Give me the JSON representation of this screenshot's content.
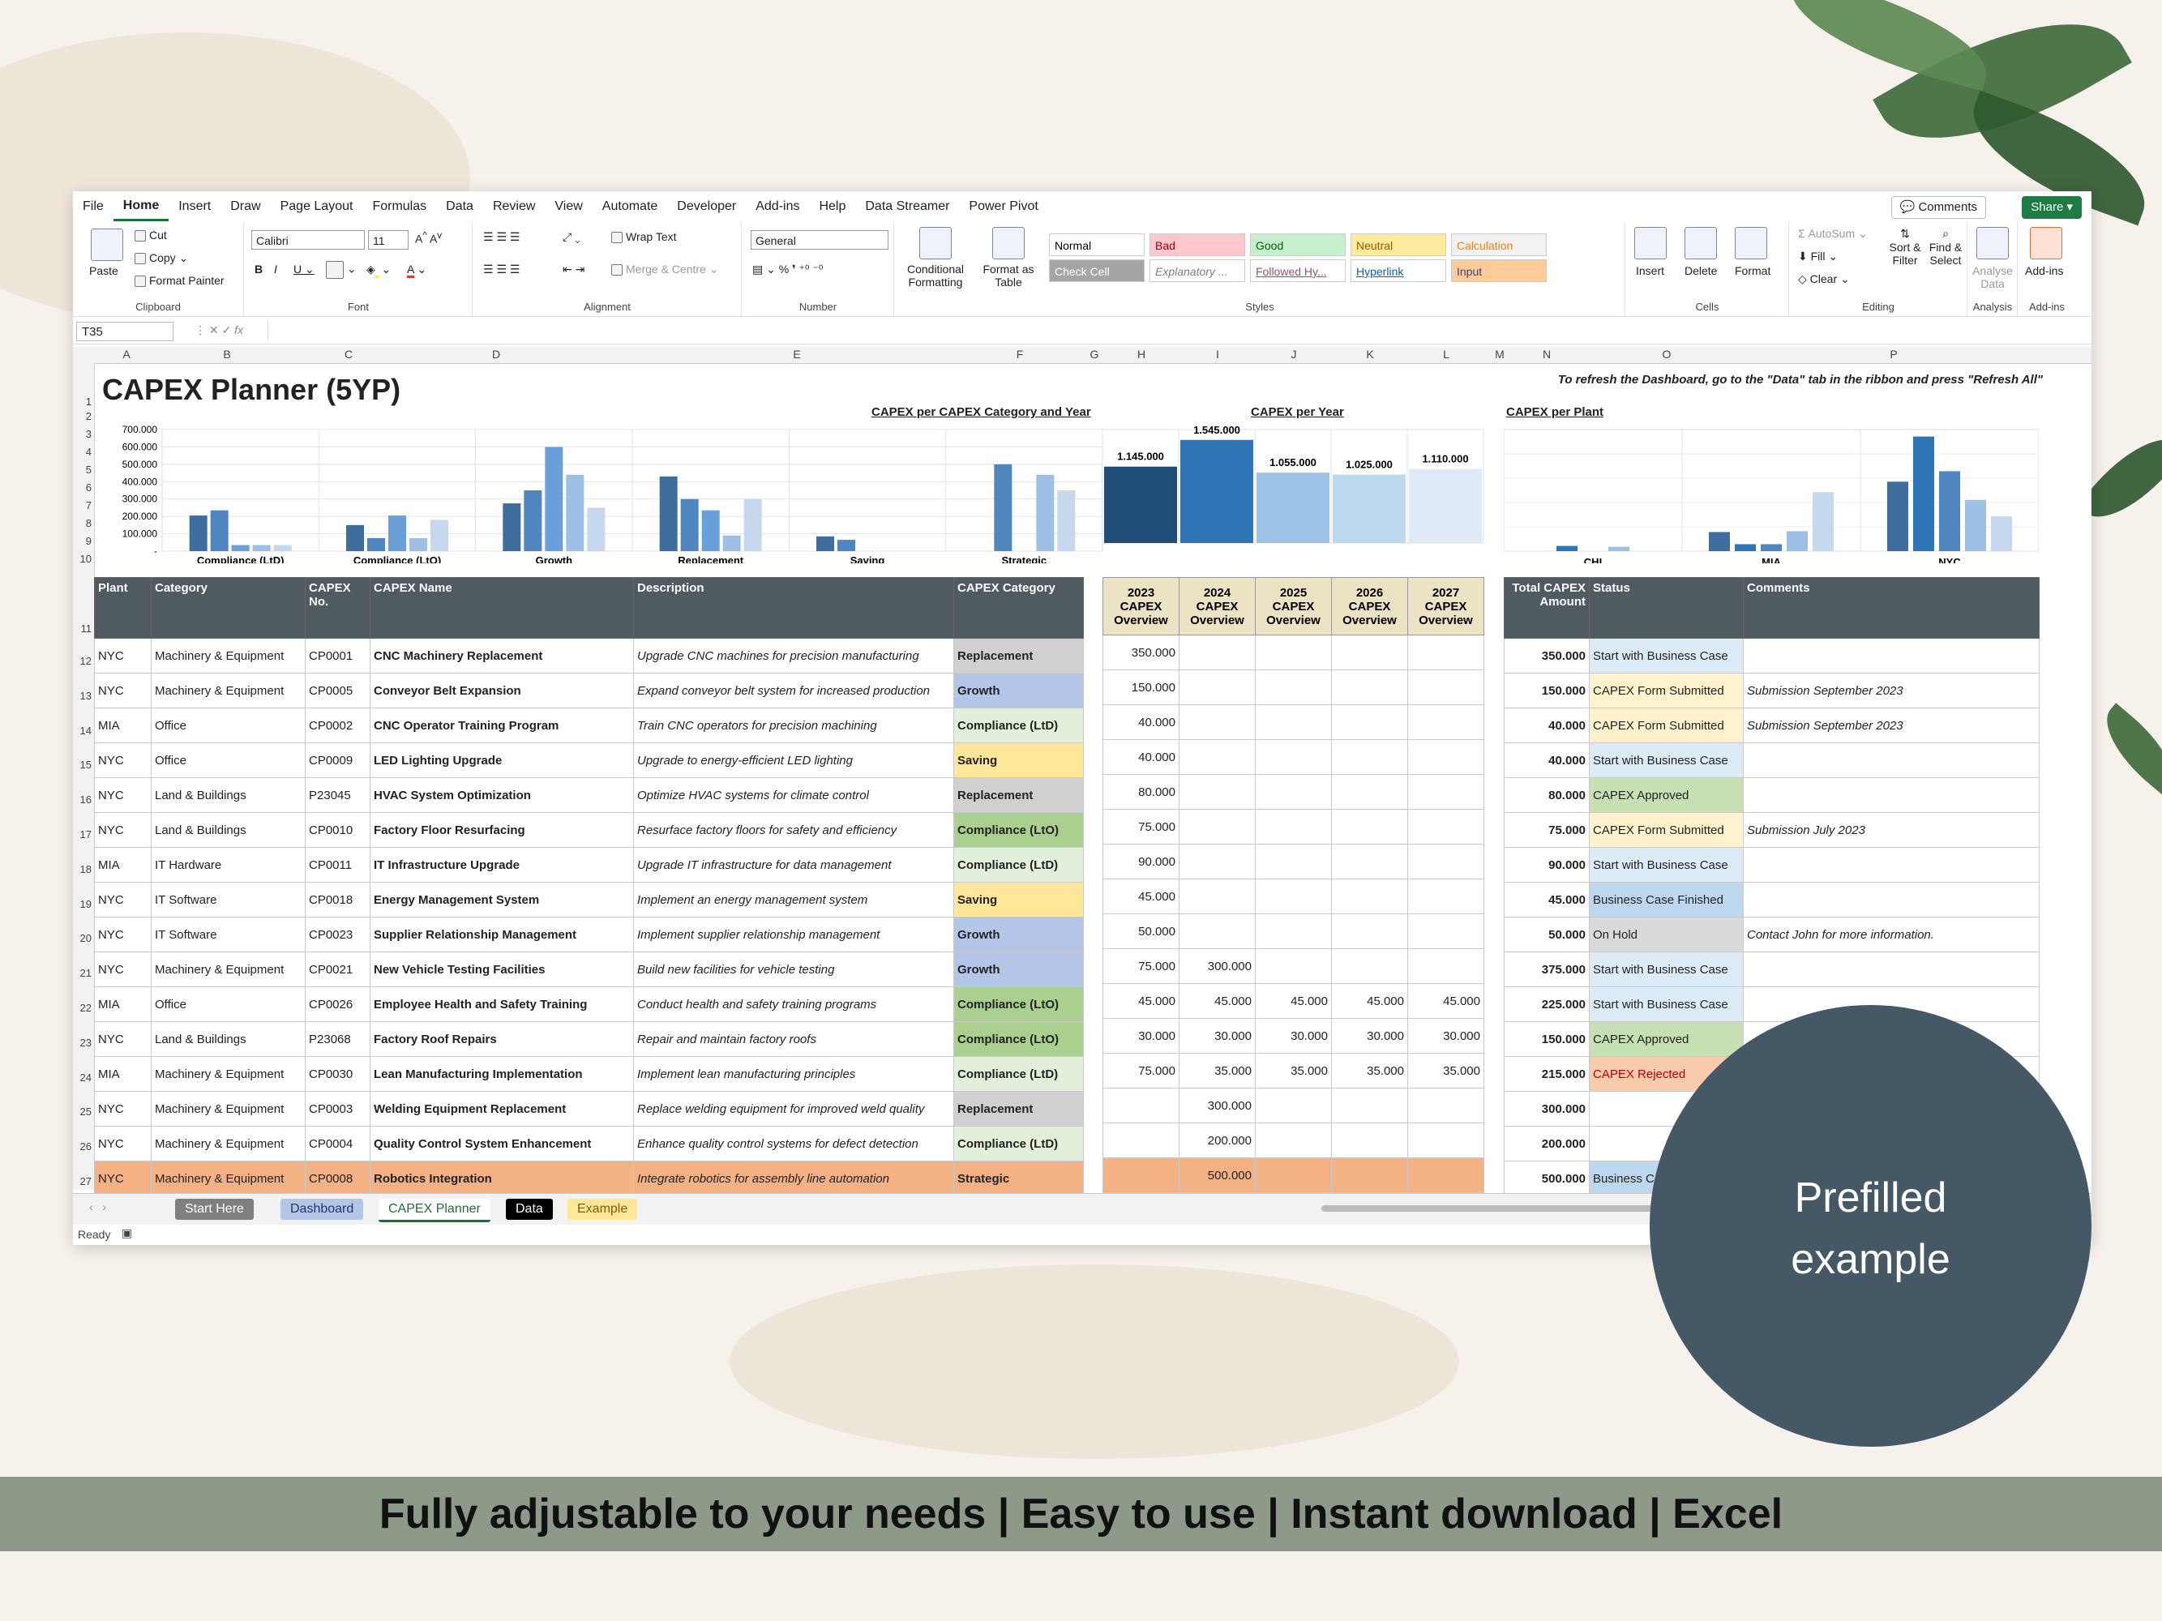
{
  "ribbon_tabs": [
    "File",
    "Home",
    "Insert",
    "Draw",
    "Page Layout",
    "Formulas",
    "Data",
    "Review",
    "View",
    "Automate",
    "Developer",
    "Add-ins",
    "Help",
    "Data Streamer",
    "Power Pivot"
  ],
  "active_tab": "Home",
  "top_buttons": {
    "comments": "Comments",
    "share": "Share"
  },
  "clipboard": {
    "paste": "Paste",
    "cut": "Cut",
    "copy": "Copy",
    "format_painter": "Format Painter",
    "label": "Clipboard"
  },
  "font": {
    "name": "Calibri",
    "size": "11",
    "label": "Font"
  },
  "alignment": {
    "wrap": "Wrap Text",
    "merge": "Merge & Centre",
    "label": "Alignment"
  },
  "number": {
    "format": "General",
    "label": "Number"
  },
  "styles": {
    "conditional": "Conditional Formatting",
    "format_table": "Format as Table",
    "label": "Styles",
    "cells": [
      {
        "text": "Normal",
        "bg": "#ffffff",
        "fg": "#000000"
      },
      {
        "text": "Bad",
        "bg": "#ffc7ce",
        "fg": "#9c0006"
      },
      {
        "text": "Good",
        "bg": "#c6efce",
        "fg": "#006100"
      },
      {
        "text": "Neutral",
        "bg": "#ffeb9c",
        "fg": "#9c5700"
      },
      {
        "text": "Calculation",
        "bg": "#f2f2f2",
        "fg": "#fa7d00"
      },
      {
        "text": "Check Cell",
        "bg": "#a5a5a5",
        "fg": "#ffffff"
      },
      {
        "text": "Explanatory ...",
        "bg": "#ffffff",
        "fg": "#7f7f7f"
      },
      {
        "text": "Followed Hy...",
        "bg": "#ffffff",
        "fg": "#954f72"
      },
      {
        "text": "Hyperlink",
        "bg": "#ffffff",
        "fg": "#0563c1"
      },
      {
        "text": "Input",
        "bg": "#ffcc99",
        "fg": "#3f3f76"
      }
    ]
  },
  "cells_group": {
    "insert": "Insert",
    "delete": "Delete",
    "format": "Format",
    "label": "Cells"
  },
  "editing": {
    "autosum": "AutoSum",
    "fill": "Fill",
    "clear": "Clear",
    "sort": "Sort & Filter",
    "find": "Find & Select",
    "label": "Editing"
  },
  "analysis": {
    "analyse": "Analyse Data",
    "label": "Analysis"
  },
  "addins": {
    "addins": "Add-ins",
    "label": "Add-ins"
  },
  "name_box": "T35",
  "fx": "fx",
  "columns": [
    "A",
    "B",
    "C",
    "D",
    "E",
    "F",
    "G",
    "H",
    "I",
    "J",
    "K",
    "L",
    "M",
    "N",
    "O",
    "P"
  ],
  "sheet_title": "CAPEX Planner (5YP)",
  "refresh_note": "To refresh the Dashboard, go to the \"Data\" tab in the ribbon and press \"Refresh All\"",
  "chart_data": [
    {
      "type": "bar",
      "title": "CAPEX per CAPEX Category and Year",
      "categories": [
        "Compliance (LtD)",
        "Compliance (LtO)",
        "Growth",
        "Replacement",
        "Saving",
        "Strategic"
      ],
      "series": [
        {
          "name": "2023",
          "values": [
            205000,
            150000,
            275000,
            430000,
            85000,
            0
          ]
        },
        {
          "name": "2024",
          "values": [
            235000,
            75000,
            350000,
            300000,
            65000,
            500000
          ]
        },
        {
          "name": "2025",
          "values": [
            35000,
            205000,
            600000,
            235000,
            0,
            0
          ]
        },
        {
          "name": "2026",
          "values": [
            35000,
            75000,
            440000,
            90000,
            0,
            440000
          ]
        },
        {
          "name": "2027",
          "values": [
            35000,
            180000,
            250000,
            300000,
            0,
            350000
          ]
        }
      ],
      "yticks": [
        "700.000",
        "600.000",
        "500.000",
        "400.000",
        "300.000",
        "200.000",
        "100.000",
        "-"
      ],
      "ylim": [
        0,
        700000
      ],
      "colors": [
        "#3f6e9e",
        "#4f86c0",
        "#6aa0d8",
        "#9dc0e6",
        "#c6d8ee"
      ]
    },
    {
      "type": "bar",
      "title": "CAPEX per Year",
      "categories": [
        "2023",
        "2024",
        "2025",
        "2026",
        "2027"
      ],
      "values": [
        1145000,
        1545000,
        1055000,
        1025000,
        1110000
      ],
      "labels": [
        "1.145.000",
        "1.545.000",
        "1.055.000",
        "1.025.000",
        "1.110.000"
      ],
      "ylim": [
        0,
        1700000
      ],
      "colors": [
        "#1f4e79",
        "#2e75b6",
        "#9dc3e6",
        "#bdd7ee",
        "#deebf7"
      ]
    },
    {
      "type": "bar",
      "title": "CAPEX per Plant",
      "categories": [
        "CHI",
        "MIA",
        "NYC"
      ],
      "series": [
        {
          "name": "2023",
          "values": [
            0,
            220000,
            800000
          ]
        },
        {
          "name": "2024",
          "values": [
            60000,
            80000,
            1320000
          ]
        },
        {
          "name": "2025",
          "values": [
            0,
            80000,
            920000
          ]
        },
        {
          "name": "2026",
          "values": [
            50000,
            230000,
            590000
          ]
        },
        {
          "name": "2027",
          "values": [
            0,
            680000,
            400000
          ]
        }
      ],
      "ylim": [
        0,
        1400000
      ],
      "colors": [
        "#3f6e9e",
        "#2e75b6",
        "#4f86c0",
        "#9dc0e6",
        "#c6d8ee"
      ]
    }
  ],
  "table": {
    "headers": [
      "Plant",
      "Category",
      "CAPEX No.",
      "CAPEX Name",
      "Description",
      "CAPEX Category"
    ],
    "year_headers": [
      "2023 CAPEX Overview",
      "2024 CAPEX Overview",
      "2025 CAPEX Overview",
      "2026 CAPEX Overview",
      "2027 CAPEX Overview"
    ],
    "total_header": "Total CAPEX Amount",
    "status_header": "Status",
    "comments_header": "Comments",
    "rows": [
      {
        "row": "12",
        "plant": "NYC",
        "cat": "Machinery & Equipment",
        "no": "CP0001",
        "name": "CNC Machinery Replacement",
        "desc": "Upgrade CNC machines for precision manufacturing",
        "ccat": "Replacement",
        "ccat_bg": "#d0d0d0",
        "years": [
          "350.000",
          "",
          "",
          "",
          ""
        ],
        "total": "350.000",
        "status": "Start with Business Case",
        "st_bg": "#ddebf7",
        "comment": ""
      },
      {
        "row": "13",
        "plant": "NYC",
        "cat": "Machinery & Equipment",
        "no": "CP0005",
        "name": "Conveyor Belt Expansion",
        "desc": "Expand conveyor belt system for increased production",
        "ccat": "Growth",
        "ccat_bg": "#b4c6e7",
        "years": [
          "150.000",
          "",
          "",
          "",
          ""
        ],
        "total": "150.000",
        "status": "CAPEX Form Submitted",
        "st_bg": "#fff2cc",
        "comment": "Submission September 2023"
      },
      {
        "row": "14",
        "plant": "MIA",
        "cat": "Office",
        "no": "CP0002",
        "name": "CNC Operator Training Program",
        "desc": "Train CNC operators for precision machining",
        "ccat": "Compliance (LtD)",
        "ccat_bg": "#e2efda",
        "years": [
          "40.000",
          "",
          "",
          "",
          ""
        ],
        "total": "40.000",
        "status": "CAPEX Form Submitted",
        "st_bg": "#fff2cc",
        "comment": "Submission September 2023"
      },
      {
        "row": "15",
        "plant": "NYC",
        "cat": "Office",
        "no": "CP0009",
        "name": "LED Lighting Upgrade",
        "desc": "Upgrade to energy-efficient LED lighting",
        "ccat": "Saving",
        "ccat_bg": "#ffe699",
        "years": [
          "40.000",
          "",
          "",
          "",
          ""
        ],
        "total": "40.000",
        "status": "Start with Business Case",
        "st_bg": "#ddebf7",
        "comment": ""
      },
      {
        "row": "16",
        "plant": "NYC",
        "cat": "Land & Buildings",
        "no": "P23045",
        "name": "HVAC System Optimization",
        "desc": "Optimize HVAC systems for climate control",
        "ccat": "Replacement",
        "ccat_bg": "#d0d0d0",
        "years": [
          "80.000",
          "",
          "",
          "",
          ""
        ],
        "total": "80.000",
        "status": "CAPEX Approved",
        "st_bg": "#c6e0b4",
        "comment": ""
      },
      {
        "row": "17",
        "plant": "NYC",
        "cat": "Land & Buildings",
        "no": "CP0010",
        "name": "Factory Floor Resurfacing",
        "desc": "Resurface factory floors for safety and efficiency",
        "ccat": "Compliance (LtO)",
        "ccat_bg": "#a9d08e",
        "years": [
          "75.000",
          "",
          "",
          "",
          ""
        ],
        "total": "75.000",
        "status": "CAPEX Form Submitted",
        "st_bg": "#fff2cc",
        "comment": "Submission July 2023"
      },
      {
        "row": "18",
        "plant": "MIA",
        "cat": "IT Hardware",
        "no": "CP0011",
        "name": "IT Infrastructure Upgrade",
        "desc": "Upgrade IT infrastructure for data management",
        "ccat": "Compliance (LtD)",
        "ccat_bg": "#e2efda",
        "years": [
          "90.000",
          "",
          "",
          "",
          ""
        ],
        "total": "90.000",
        "status": "Start with Business Case",
        "st_bg": "#ddebf7",
        "comment": ""
      },
      {
        "row": "19",
        "plant": "NYC",
        "cat": "IT Software",
        "no": "CP0018",
        "name": "Energy Management System",
        "desc": "Implement an energy management system",
        "ccat": "Saving",
        "ccat_bg": "#ffe699",
        "years": [
          "45.000",
          "",
          "",
          "",
          ""
        ],
        "total": "45.000",
        "status": "Business Case Finished",
        "st_bg": "#bdd7ee",
        "comment": ""
      },
      {
        "row": "20",
        "plant": "NYC",
        "cat": "IT Software",
        "no": "CP0023",
        "name": "Supplier Relationship Management",
        "desc": "Implement supplier relationship management",
        "ccat": "Growth",
        "ccat_bg": "#b4c6e7",
        "years": [
          "50.000",
          "",
          "",
          "",
          ""
        ],
        "total": "50.000",
        "status": "On Hold",
        "st_bg": "#d9d9d9",
        "comment": "Contact John for more information."
      },
      {
        "row": "21",
        "plant": "NYC",
        "cat": "Machinery & Equipment",
        "no": "CP0021",
        "name": "New Vehicle Testing Facilities",
        "desc": "Build new facilities for vehicle testing",
        "ccat": "Growth",
        "ccat_bg": "#b4c6e7",
        "years": [
          "75.000",
          "300.000",
          "",
          "",
          ""
        ],
        "total": "375.000",
        "status": "Start with Business Case",
        "st_bg": "#ddebf7",
        "comment": ""
      },
      {
        "row": "22",
        "plant": "MIA",
        "cat": "Office",
        "no": "CP0026",
        "name": "Employee Health and Safety Training",
        "desc": "Conduct health and safety training programs",
        "ccat": "Compliance (LtO)",
        "ccat_bg": "#a9d08e",
        "years": [
          "45.000",
          "45.000",
          "45.000",
          "45.000",
          "45.000"
        ],
        "total": "225.000",
        "status": "Start with Business Case",
        "st_bg": "#ddebf7",
        "comment": ""
      },
      {
        "row": "23",
        "plant": "NYC",
        "cat": "Land & Buildings",
        "no": "P23068",
        "name": "Factory Roof Repairs",
        "desc": "Repair and maintain factory roofs",
        "ccat": "Compliance (LtO)",
        "ccat_bg": "#a9d08e",
        "years": [
          "30.000",
          "30.000",
          "30.000",
          "30.000",
          "30.000"
        ],
        "total": "150.000",
        "status": "CAPEX Approved",
        "st_bg": "#c6e0b4",
        "comment": ""
      },
      {
        "row": "24",
        "plant": "MIA",
        "cat": "Machinery & Equipment",
        "no": "CP0030",
        "name": "Lean Manufacturing Implementation",
        "desc": "Implement lean manufacturing principles",
        "ccat": "Compliance (LtD)",
        "ccat_bg": "#e2efda",
        "years": [
          "75.000",
          "35.000",
          "35.000",
          "35.000",
          "35.000"
        ],
        "total": "215.000",
        "status": "CAPEX Rejected",
        "st_bg": "#f8cbad",
        "comment": ""
      },
      {
        "row": "25",
        "plant": "NYC",
        "cat": "Machinery & Equipment",
        "no": "CP0003",
        "name": "Welding Equipment Replacement",
        "desc": "Replace welding equipment for improved weld quality",
        "ccat": "Replacement",
        "ccat_bg": "#d0d0d0",
        "years": [
          "",
          "300.000",
          "",
          "",
          ""
        ],
        "total": "300.000",
        "status": "",
        "st_bg": "#ffffff",
        "comment": ""
      },
      {
        "row": "26",
        "plant": "NYC",
        "cat": "Machinery & Equipment",
        "no": "CP0004",
        "name": "Quality Control System Enhancement",
        "desc": "Enhance quality control systems for defect detection",
        "ccat": "Compliance (LtD)",
        "ccat_bg": "#e2efda",
        "years": [
          "",
          "200.000",
          "",
          "",
          ""
        ],
        "total": "200.000",
        "status": "",
        "st_bg": "#ffffff",
        "comment": ""
      },
      {
        "row": "27",
        "plant": "NYC",
        "cat": "Machinery & Equipment",
        "no": "CP0008",
        "name": "Robotics Integration",
        "desc": "Integrate robotics for assembly line automation",
        "ccat": "Strategic",
        "ccat_bg": "#f4b183",
        "years": [
          "",
          "500.000",
          "",
          "",
          ""
        ],
        "total": "500.000",
        "status": "Business Ca",
        "st_bg": "#bdd7ee",
        "comment": "",
        "highlight": "#f4b183"
      }
    ]
  },
  "sheet_tabs": [
    {
      "label": "Start Here",
      "bg": "#7f7f7f",
      "fg": "#ffffff"
    },
    {
      "label": "Dashboard",
      "bg": "#b4c6e7",
      "fg": "#1f3864"
    },
    {
      "label": "CAPEX Planner",
      "bg": "#ffffff",
      "fg": "#1e6e3a"
    },
    {
      "label": "Data",
      "bg": "#000000",
      "fg": "#ffffff"
    },
    {
      "label": "Example",
      "bg": "#ffe699",
      "fg": "#7f6000"
    }
  ],
  "status_ready": "Ready",
  "badge": {
    "line1": "Prefilled",
    "line2": "example"
  },
  "banner": "Fully adjustable to your needs | Easy to use | Instant download | Excel"
}
